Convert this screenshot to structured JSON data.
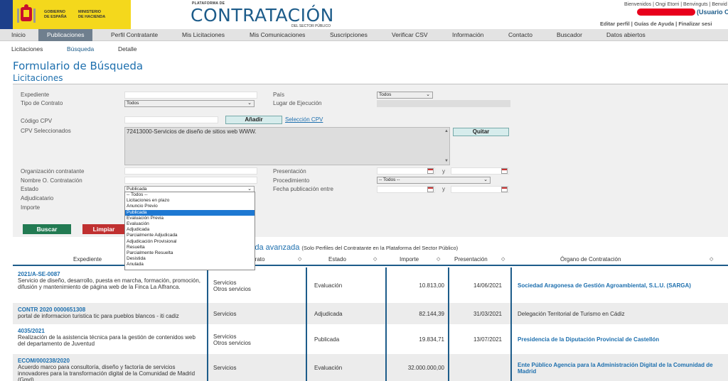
{
  "header": {
    "gov_line1": "GOBIERNO",
    "gov_line2": "DE ESPAÑA",
    "min_line1": "MINISTERIO",
    "min_line2": "DE HACIENDA",
    "brand_small": "PLATAFORMA DE",
    "brand": "CONTRATACIÓN",
    "brand_sub": "DEL SECTOR PÚBLICO",
    "top_links": "Bienvenidos | Ongi Etorri | Benvinguts | Benvid",
    "usuario": "(Usuario O",
    "user_links": "Editar perfil | Guías de Ayuda | Finalizar sesi"
  },
  "nav": {
    "items": [
      "Inicio",
      "Publicaciones",
      "Perfil Contratante",
      "Mis Licitaciones",
      "Mis Comunicaciones",
      "Suscripciones",
      "Verificar CSV",
      "Información",
      "Contacto",
      "Buscador",
      "Datos abiertos"
    ]
  },
  "subnav": {
    "items": [
      "Licitaciones",
      "Búsqueda",
      "Detalle"
    ]
  },
  "page": {
    "title": "Formulario de Búsqueda",
    "subtitle": "Licitaciones"
  },
  "form": {
    "expediente": "Expediente",
    "tipo_contrato": "Tipo de Contrato",
    "tipo_contrato_value": "Todos",
    "pais": "País",
    "pais_value": "Todos",
    "lugar": "Lugar de Ejecución",
    "codigo_cpv": "Código CPV",
    "anadir": "Añadir",
    "seleccion_cpv": "Selección CPV",
    "cpv_seleccionados": "CPV Seleccionados",
    "cpv_value": "72413000-Servicios de diseño de sitios web WWW.",
    "quitar": "Quitar",
    "organizacion": "Organización contratante",
    "nombre_o": "Nombre O. Contratación",
    "estado": "Estado",
    "estado_value": "Publicada",
    "adjudicatario": "Adjudicatario",
    "importe": "Importe",
    "presentacion": "Presentación",
    "procedimiento": "Procedimiento",
    "procedimiento_value": "-- Todos --",
    "fecha_pub": "Fecha publicación entre",
    "y": "y",
    "buscar": "Buscar",
    "limpiar": "Limpiar"
  },
  "estado_options": [
    "-- Todos --",
    "Licitaciones en plazo",
    "Anuncio Previo",
    "Publicada",
    "Evaluación Previa",
    "Evaluación",
    "Adjudicada",
    "Parcialmente Adjudicada",
    "Adjudicación Provisional",
    "Resuelta",
    "Parcialmente Resuelta",
    "Desistida",
    "Anulada"
  ],
  "results": {
    "adv_title": "queda avanzada",
    "adv_note": "(Solo Perfiles del Contratante en la Plataforma del Sector Público)",
    "headers": {
      "expediente": "Expediente",
      "contrato": "ntrato",
      "estado": "Estado",
      "importe": "Importe",
      "presentacion": "Presentación",
      "organo": "Órgano de Contratación"
    },
    "rows": [
      {
        "id": "2021/A-SE-0087",
        "desc": "Servicio de diseño, desarrollo, puesta en marcha, formación, promoción, difusión y mantenimiento de página web de la Finca La Alfranca.",
        "tipo1": "Servicios",
        "tipo2": "Otros servicios",
        "estado": "Evaluación",
        "importe": "10.813,00",
        "fecha": "14/06/2021",
        "organo": "Sociedad Aragonesa de Gestión Agroambiental, S.L.U. (SARGA)",
        "organo_link": true
      },
      {
        "id": "CONTR 2020 0000651308",
        "desc": "portal de informacion turistica tic para pueblos blancos - iti cadiz",
        "tipo1": "Servicios",
        "tipo2": "",
        "estado": "Adjudicada",
        "importe": "82.144,39",
        "fecha": "31/03/2021",
        "organo": "Delegación Territorial de Turismo en Cádiz",
        "organo_link": false
      },
      {
        "id": "4035/2021",
        "desc": "Realización de la asistencia técnica para la gestión de contenidos web del departamento de Juventud",
        "tipo1": "Servicios",
        "tipo2": "Otros servicios",
        "estado": "Publicada",
        "importe": "19.834,71",
        "fecha": "13/07/2021",
        "organo": "Presidencia de la Diputación Provincial de Castellón",
        "organo_link": true
      },
      {
        "id": "ECOM/000238/2020",
        "desc": "Acuerdo marco para consultoría, diseño y factoría de servicios innovadores para la transformación digital de la Comunidad de Madrid (Gmd)",
        "tipo1": "Servicios",
        "tipo2": "",
        "estado": "Evaluación",
        "importe": "32.000.000,00",
        "fecha": "",
        "organo": "Ente Público Agencia para la Administración Digital de la Comunidad de Madrid",
        "organo_link": true
      }
    ]
  }
}
